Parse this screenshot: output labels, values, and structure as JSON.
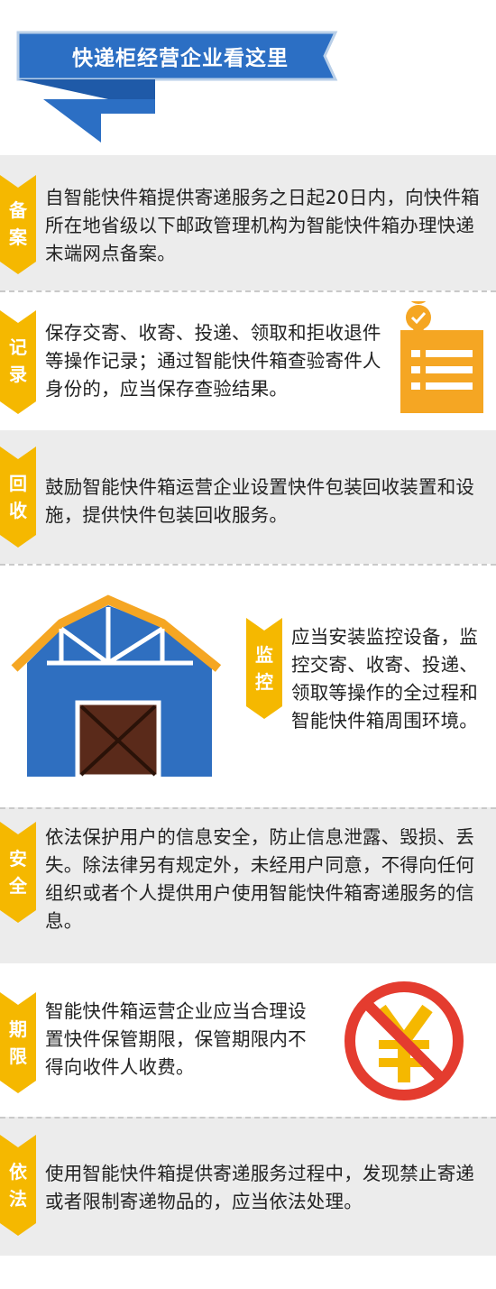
{
  "header": {
    "title": "快递柜经营企业看这里"
  },
  "sections": [
    {
      "badge": [
        "备",
        "案"
      ],
      "text": "自智能快件箱提供寄递服务之日起20日内，向快件箱所在地省级以下邮政管理机构为智能快件箱办理快递末端网点备案。"
    },
    {
      "badge": [
        "记",
        "录"
      ],
      "text": "保存交寄、收寄、投递、领取和拒收退件等操作记录；通过智能快件箱查验寄件人身份的，应当保存查验结果。"
    },
    {
      "badge": [
        "回",
        "收"
      ],
      "text": "鼓励智能快件箱运营企业设置快件包装回收装置和设施，提供快件包装回收服务。"
    },
    {
      "badge": [
        "监",
        "控"
      ],
      "text": "应当安装监控设备，监控交寄、收寄、投递、领取等操作的全过程和智能快件箱周围环境。"
    },
    {
      "badge": [
        "安",
        "全"
      ],
      "text": "依法保护用户的信息安全，防止信息泄露、毁损、丢失。除法律另有规定外，未经用户同意，不得向任何组织或者个人提供用户使用智能快件箱寄递服务的信息。"
    },
    {
      "badge": [
        "期",
        "限"
      ],
      "text": "智能快件箱运营企业应当合理设置快件保管期限，保管期限内不得向收件人收费。"
    },
    {
      "badge": [
        "依",
        "法"
      ],
      "text": "使用智能快件箱提供寄递服务过程中，发现禁止寄递或者限制寄递物品的，应当依法处理。"
    }
  ],
  "icons": {
    "checklist": "clipboard-check-icon",
    "warehouse": "warehouse-icon",
    "no_fee": "no-yuan-icon"
  },
  "colors": {
    "banner_blue": "#2c6fc4",
    "badge_yellow": "#f5b800",
    "section_grey": "#ececec",
    "accent_orange": "#f5a623",
    "warehouse_blue": "#2f6fc0",
    "door_brown": "#5a2a1a",
    "prohibit_red": "#e43c2f"
  }
}
